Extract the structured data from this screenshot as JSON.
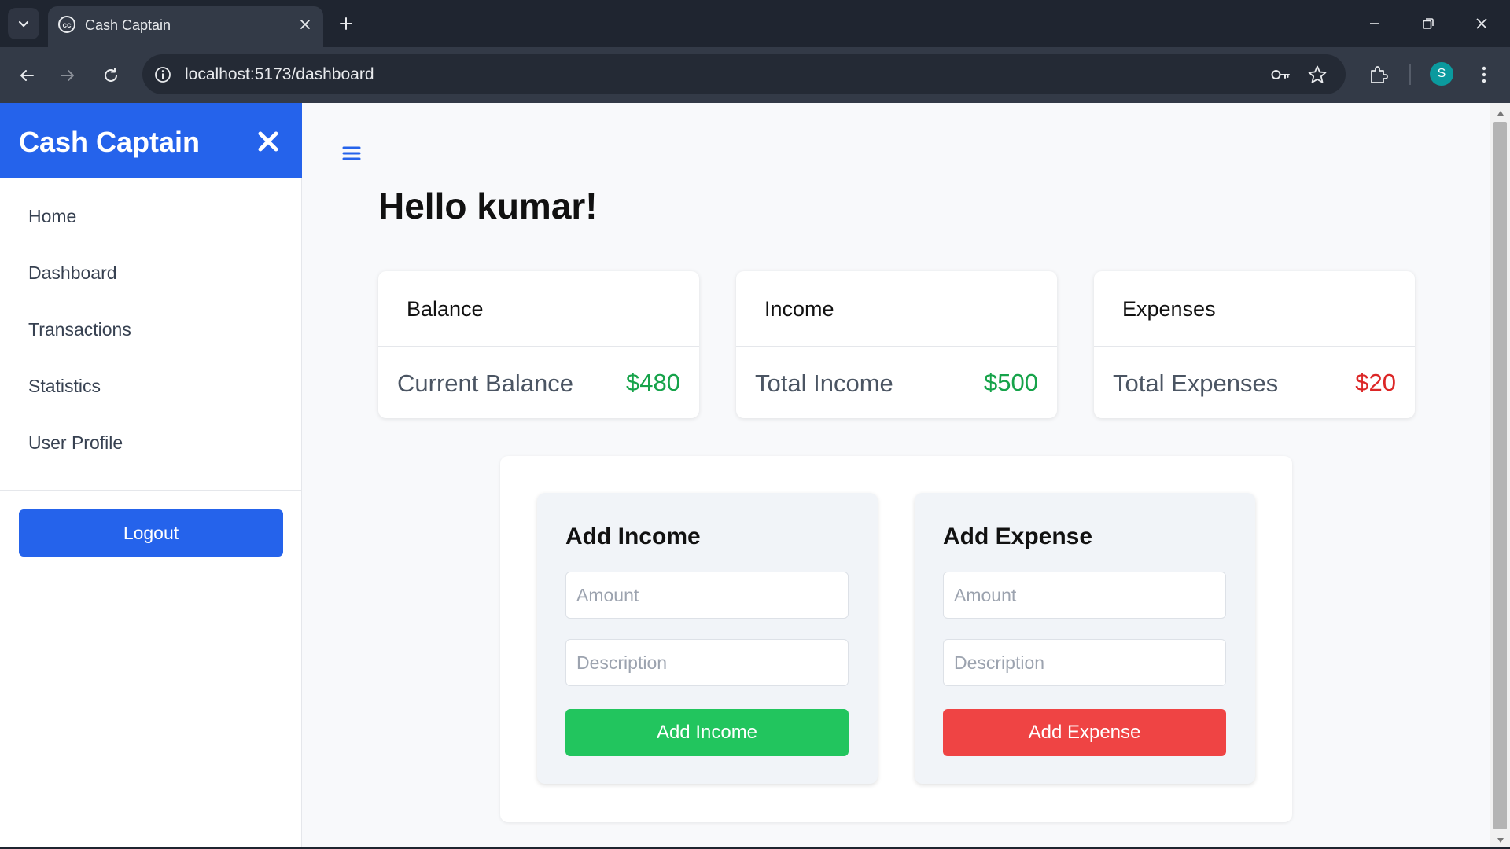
{
  "browser": {
    "tab_title": "Cash Captain",
    "url": "localhost:5173/dashboard",
    "profile_initial": "S"
  },
  "sidebar": {
    "brand": "Cash Captain",
    "items": [
      {
        "label": "Home"
      },
      {
        "label": "Dashboard"
      },
      {
        "label": "Transactions"
      },
      {
        "label": "Statistics"
      },
      {
        "label": "User Profile"
      }
    ],
    "logout_label": "Logout"
  },
  "main": {
    "greeting": "Hello kumar!",
    "cards": [
      {
        "title": "Balance",
        "label": "Current Balance",
        "value": "$480",
        "color": "#16a34a"
      },
      {
        "title": "Income",
        "label": "Total Income",
        "value": "$500",
        "color": "#16a34a"
      },
      {
        "title": "Expenses",
        "label": "Total Expenses",
        "value": "$20",
        "color": "#dc2626"
      }
    ],
    "income_form": {
      "title": "Add Income",
      "amount_placeholder": "Amount",
      "description_placeholder": "Description",
      "button_label": "Add Income",
      "button_color": "#22c55e"
    },
    "expense_form": {
      "title": "Add Expense",
      "amount_placeholder": "Amount",
      "description_placeholder": "Description",
      "button_label": "Add Expense",
      "button_color": "#ef4444"
    }
  },
  "colors": {
    "primary": "#2563eb",
    "income": "#16a34a",
    "expense": "#dc2626"
  }
}
